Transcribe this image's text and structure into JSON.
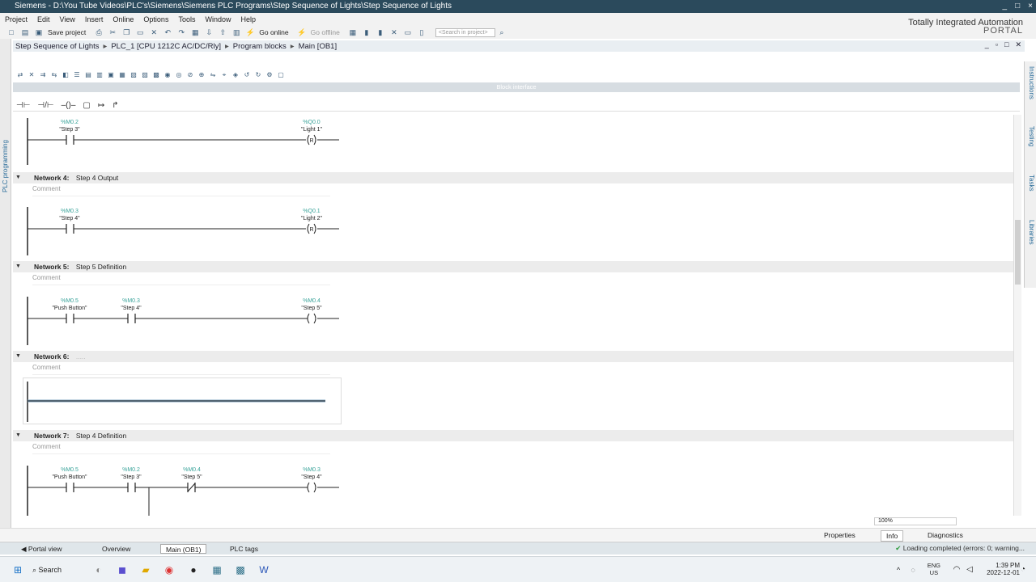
{
  "window": {
    "title": "Siemens - D:\\You Tube Videos\\PLC's\\Siemens\\Siemens PLC Programs\\Step Sequence of Lights\\Step Sequence of Lights",
    "controls": [
      "_",
      "□",
      "×"
    ]
  },
  "menu": [
    "Project",
    "Edit",
    "View",
    "Insert",
    "Online",
    "Options",
    "Tools",
    "Window",
    "Help"
  ],
  "toolbar": {
    "save_project": "Save project",
    "go_online": "Go online",
    "go_offline": "Go offline",
    "search_placeholder": "<Search in project>"
  },
  "branding": {
    "line1": "Totally Integrated Automation",
    "line2": "PORTAL"
  },
  "breadcrumb": [
    "Step Sequence of Lights",
    "PLC_1 [CPU 1212C AC/DC/Rly]",
    "Program blocks",
    "Main [OB1]"
  ],
  "side_tabs": {
    "left": "PLC programming",
    "right": [
      "Instructions",
      "Testing",
      "Tasks",
      "Libraries"
    ]
  },
  "block_interface": "Block interface",
  "comment_placeholder": "Comment",
  "networks": [
    {
      "id": "partial-3",
      "header": null,
      "contacts": [
        {
          "addr": "%M0.2",
          "name": "\"Step 3\"",
          "type": "NO"
        }
      ],
      "coil": {
        "addr": "%Q0.0",
        "name": "\"Light 1\"",
        "type": "R"
      }
    },
    {
      "id": "net-4",
      "number": "Network 4:",
      "title": "Step 4 Output",
      "contacts": [
        {
          "addr": "%M0.3",
          "name": "\"Step 4\"",
          "type": "NO"
        }
      ],
      "coil": {
        "addr": "%Q0.1",
        "name": "\"Light 2\"",
        "type": "R"
      }
    },
    {
      "id": "net-5",
      "number": "Network 5:",
      "title": "Step 5 Definition",
      "contacts": [
        {
          "addr": "%M0.5",
          "name": "\"Push Button\"",
          "type": "NO"
        },
        {
          "addr": "%M0.3",
          "name": "\"Step 4\"",
          "type": "NO"
        }
      ],
      "coil": {
        "addr": "%M0.4",
        "name": "\"Step 5\"",
        "type": "S"
      }
    },
    {
      "id": "net-6",
      "number": "Network 6:",
      "title": "....."
    },
    {
      "id": "net-7",
      "number": "Network 7:",
      "title": "Step 4 Definition",
      "contacts": [
        {
          "addr": "%M0.5",
          "name": "\"Push Button\"",
          "type": "NO"
        },
        {
          "addr": "%M0.2",
          "name": "\"Step 3\"",
          "type": "NO"
        },
        {
          "addr": "%M0.4",
          "name": "\"Step 5\"",
          "type": "NC"
        }
      ],
      "coil": {
        "addr": "%M0.3",
        "name": "\"Step 4\"",
        "type": "S"
      }
    }
  ],
  "zoom": "100%",
  "inspector_tabs": [
    "Properties",
    "Info",
    "Diagnostics"
  ],
  "bottom": {
    "portal_view": "Portal view",
    "tabs": [
      "Overview",
      "Main (OB1)",
      "PLC tags"
    ],
    "status": "Loading completed (errors: 0; warning..."
  },
  "taskbar": {
    "search": "Search",
    "lang": [
      "ENG",
      "US"
    ],
    "time": "1:39 PM",
    "date": "2022-12-01"
  }
}
